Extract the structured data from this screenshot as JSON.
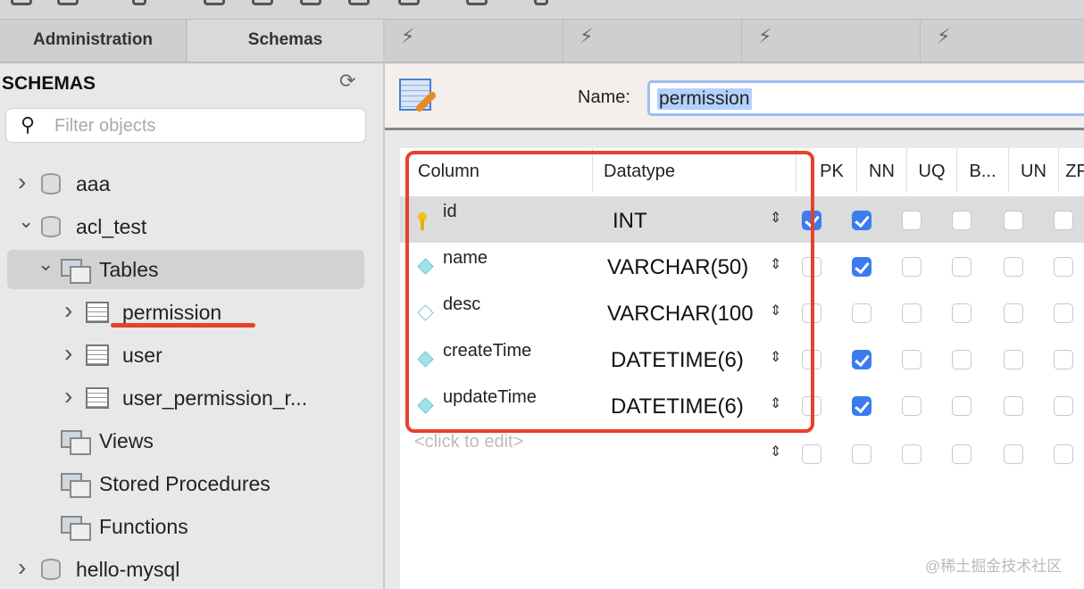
{
  "tabs": {
    "administration": "Administration",
    "schemas": "Schemas"
  },
  "sidebar": {
    "title": "SCHEMAS",
    "filter_placeholder": "Filter objects",
    "tree": [
      {
        "label": "aaa",
        "type": "schema",
        "level": 0,
        "expanded": false
      },
      {
        "label": "acl_test",
        "type": "schema",
        "level": 0,
        "expanded": true
      },
      {
        "label": "Tables",
        "type": "folder",
        "level": 1,
        "expanded": true,
        "selected": true
      },
      {
        "label": "permission",
        "type": "table",
        "level": 2,
        "expanded": false,
        "underlined": true
      },
      {
        "label": "user",
        "type": "table",
        "level": 2,
        "expanded": false
      },
      {
        "label": "user_permission_r...",
        "type": "table",
        "level": 2,
        "expanded": false
      },
      {
        "label": "Views",
        "type": "folder",
        "level": 1
      },
      {
        "label": "Stored Procedures",
        "type": "folder",
        "level": 1
      },
      {
        "label": "Functions",
        "type": "folder",
        "level": 1
      },
      {
        "label": "hello-mysql",
        "type": "schema",
        "level": 0,
        "expanded": false
      }
    ]
  },
  "editor": {
    "name_label": "Name:",
    "name_value": "permission",
    "columns_header": [
      "Column",
      "Datatype",
      "PK",
      "NN",
      "UQ",
      "B...",
      "UN",
      "ZF"
    ],
    "rows": [
      {
        "name": "id",
        "type": "INT",
        "key": "primary",
        "flags": [
          true,
          true,
          false,
          false,
          false,
          false
        ],
        "selected": true
      },
      {
        "name": "name",
        "type": "VARCHAR(50)",
        "key": "column",
        "flags": [
          false,
          true,
          false,
          false,
          false,
          false
        ]
      },
      {
        "name": "desc",
        "type": "VARCHAR(100",
        "key": "nullable",
        "flags": [
          false,
          false,
          false,
          false,
          false,
          false
        ]
      },
      {
        "name": "createTime",
        "type": "DATETIME(6)",
        "key": "column",
        "flags": [
          false,
          true,
          false,
          false,
          false,
          false
        ]
      },
      {
        "name": "updateTime",
        "type": "DATETIME(6)",
        "key": "column",
        "flags": [
          false,
          true,
          false,
          false,
          false,
          false
        ]
      }
    ],
    "new_row_placeholder": "<click to edit>"
  },
  "annotation_color": "#e8402a",
  "watermark": "@稀土掘金技术社区"
}
